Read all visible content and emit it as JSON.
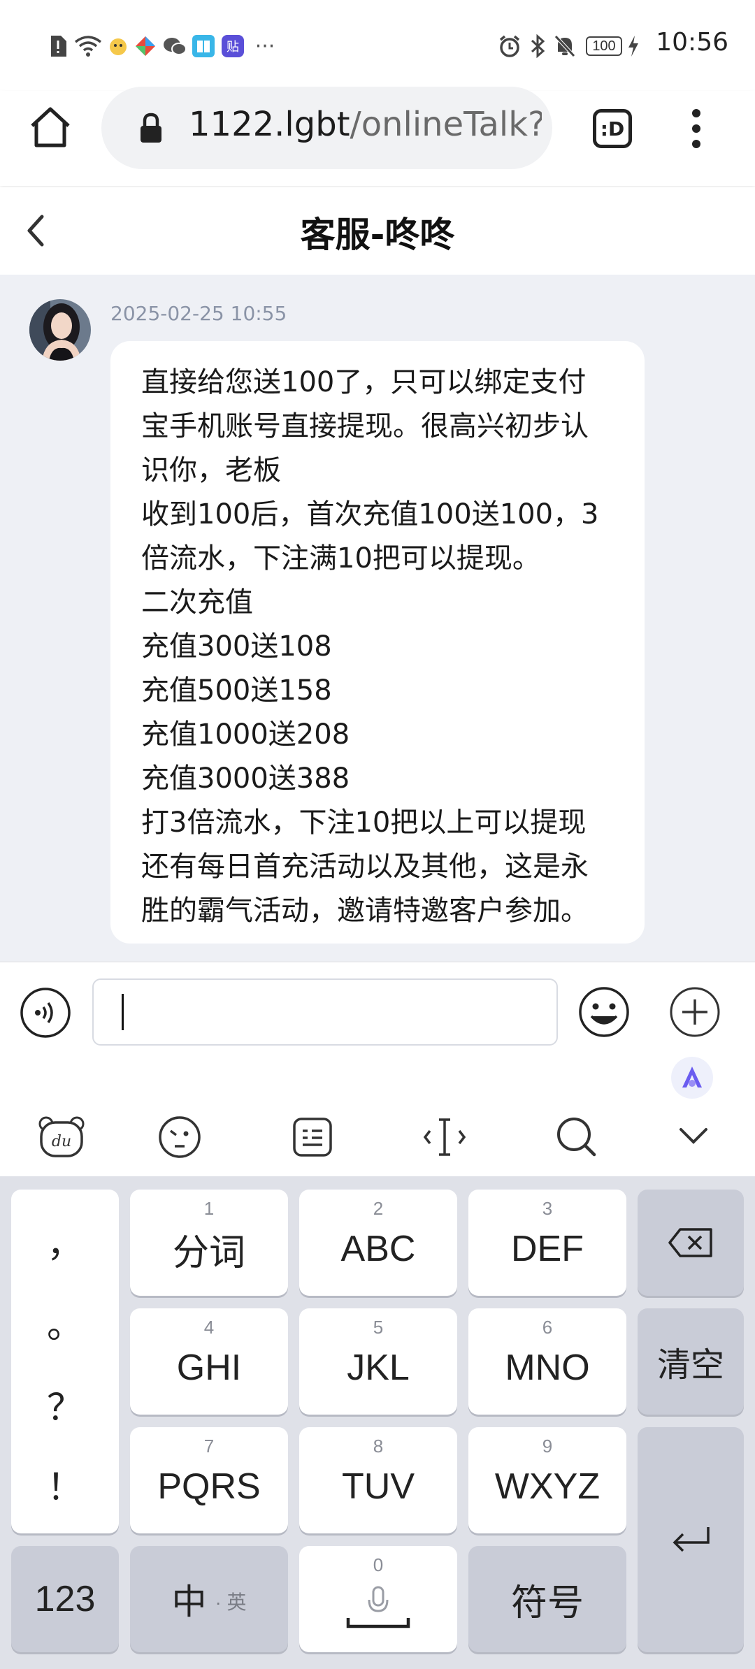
{
  "status_bar": {
    "time": "10:56",
    "battery": "100"
  },
  "browser": {
    "url_host": "1122.lgbt",
    "url_path": "/onlineTalk?to",
    "tab_label": ":D"
  },
  "chat": {
    "title": "客服-咚咚",
    "message": {
      "timestamp": "2025-02-25 10:55",
      "text": "直接给您送100了，只可以绑定支付宝手机账号直接提现。很高兴初步认识你，老板\n收到100后，首次充值100送100，3倍流水，下注满10把可以提现。\n二次充值\n充值300送108\n充值500送158\n充值1000送208\n充值3000送388\n打3倍流水，下注10把以上可以提现\n还有每日首充活动以及其他，这是永胜的霸气活动，邀请特邀客户参加。"
    },
    "input_value": ""
  },
  "ime_toolbar": {
    "items": [
      "du-bear-icon",
      "emoji-face-icon",
      "clipboard-icon",
      "cursor-icon",
      "search-icon",
      "collapse-icon"
    ]
  },
  "keyboard": {
    "punct": [
      "，",
      "。",
      "？",
      "！"
    ],
    "keys": [
      {
        "num": "1",
        "label": "分词"
      },
      {
        "num": "2",
        "label": "ABC"
      },
      {
        "num": "3",
        "label": "DEF"
      },
      {
        "num": "4",
        "label": "GHI"
      },
      {
        "num": "5",
        "label": "JKL"
      },
      {
        "num": "6",
        "label": "MNO"
      },
      {
        "num": "7",
        "label": "PQRS"
      },
      {
        "num": "8",
        "label": "TUV"
      },
      {
        "num": "9",
        "label": "WXYZ"
      }
    ],
    "clear_label": "清空",
    "num_switch_label": "123",
    "lang_main": "中",
    "lang_alt": "· 英",
    "space_num": "0",
    "symbol_label": "符号"
  },
  "colors": {
    "chat_bg": "#eef0f5",
    "keyboard_bg": "#dfe1e8",
    "gray_key": "#c9ccd7"
  }
}
